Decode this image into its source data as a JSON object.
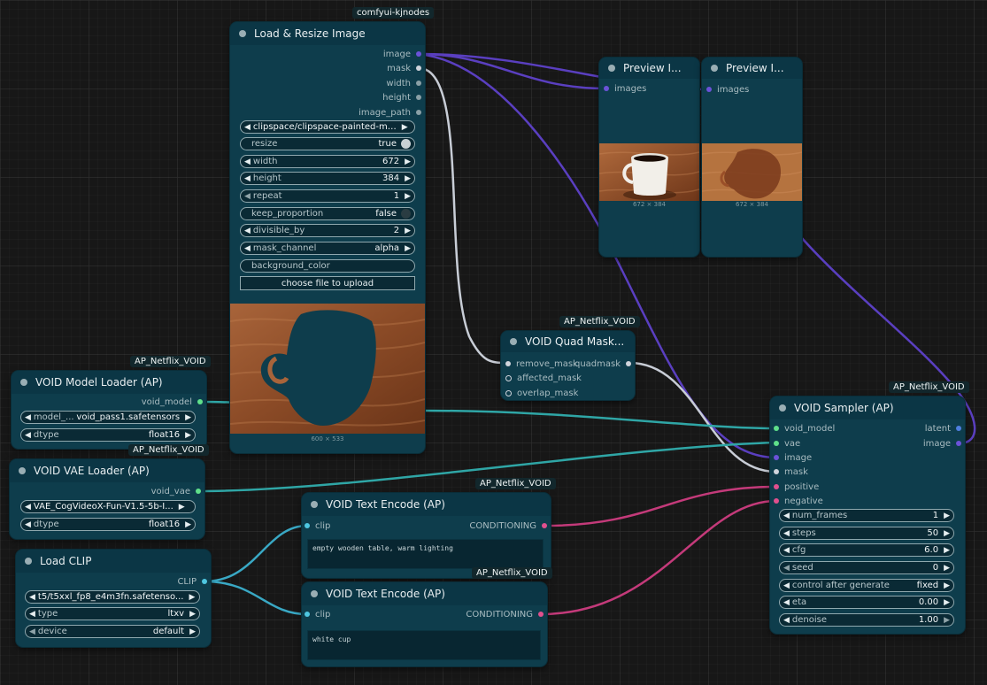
{
  "colors": {
    "image_link": "#5a3fc0",
    "mask_link": "#c8cdd6",
    "model_link": "#2fa6a6",
    "clip_link": "#39a8c4",
    "conditioning_link": "#c43a7a",
    "node_body": "#0e3d4c",
    "node_title": "#0b3645"
  },
  "load_resize": {
    "badge": "comfyui-kjnodes",
    "title": "Load & Resize Image",
    "outputs": [
      "image",
      "mask",
      "width",
      "height",
      "image_path"
    ],
    "file": "clipspace/clipspace-painted-m…",
    "resize_label": "resize",
    "resize_value": "true",
    "width_label": "width",
    "width_value": "672",
    "height_label": "height",
    "height_value": "384",
    "repeat_label": "repeat",
    "repeat_value": "1",
    "keep_label": "keep_proportion",
    "keep_value": "false",
    "divisible_label": "divisible_by",
    "divisible_value": "2",
    "mask_channel_label": "mask_channel",
    "mask_channel_value": "alpha",
    "bg_label": "background_color",
    "upload_label": "choose file to upload",
    "image_caption": "600 × 533"
  },
  "preview1": {
    "title": "Preview I...",
    "input": "images",
    "caption": "672 × 384"
  },
  "preview2": {
    "title": "Preview I...",
    "input": "images",
    "caption": "672 × 384"
  },
  "quad_mask": {
    "badge": "AP_Netflix_VOID",
    "title": "VOID Quad Mask...",
    "inputs": [
      "remove_mask",
      "affected_mask",
      "overlap_mask"
    ],
    "output": "quadmask"
  },
  "model_loader": {
    "badge": "AP_Netflix_VOID",
    "title": "VOID Model Loader (AP)",
    "output": "void_model",
    "model_label": "model_...",
    "model_value": "void_pass1.safetensors",
    "dtype_label": "dtype",
    "dtype_value": "float16"
  },
  "vae_loader": {
    "badge": "AP_Netflix_VOID",
    "title": "VOID VAE Loader (AP)",
    "output": "void_vae",
    "vae_value": "VAE_CogVideoX-Fun-V1.5-5b-I...",
    "dtype_label": "dtype",
    "dtype_value": "float16"
  },
  "load_clip": {
    "title": "Load CLIP",
    "output": "CLIP",
    "clip_value": "t5/t5xxl_fp8_e4m3fn.safetenso...",
    "type_label": "type",
    "type_value": "ltxv",
    "device_label": "device",
    "device_value": "default"
  },
  "text_encode1": {
    "badge": "AP_Netflix_VOID",
    "title": "VOID Text Encode (AP)",
    "input": "clip",
    "output": "CONDITIONING",
    "text": "empty wooden table, warm lighting"
  },
  "text_encode2": {
    "badge": "AP_Netflix_VOID",
    "title": "VOID Text Encode (AP)",
    "input": "clip",
    "output": "CONDITIONING",
    "text": "white cup"
  },
  "sampler": {
    "badge": "AP_Netflix_VOID",
    "title": "VOID Sampler (AP)",
    "inputs": [
      "void_model",
      "vae",
      "image",
      "mask",
      "positive",
      "negative"
    ],
    "outputs": [
      "latent",
      "image"
    ],
    "widgets": [
      {
        "label": "num_frames",
        "value": "1"
      },
      {
        "label": "steps",
        "value": "50"
      },
      {
        "label": "cfg",
        "value": "6.0"
      },
      {
        "label": "seed",
        "value": "0"
      },
      {
        "label": "control after generate",
        "value": "fixed"
      },
      {
        "label": "eta",
        "value": "0.00"
      },
      {
        "label": "denoise",
        "value": "1.00"
      }
    ]
  }
}
